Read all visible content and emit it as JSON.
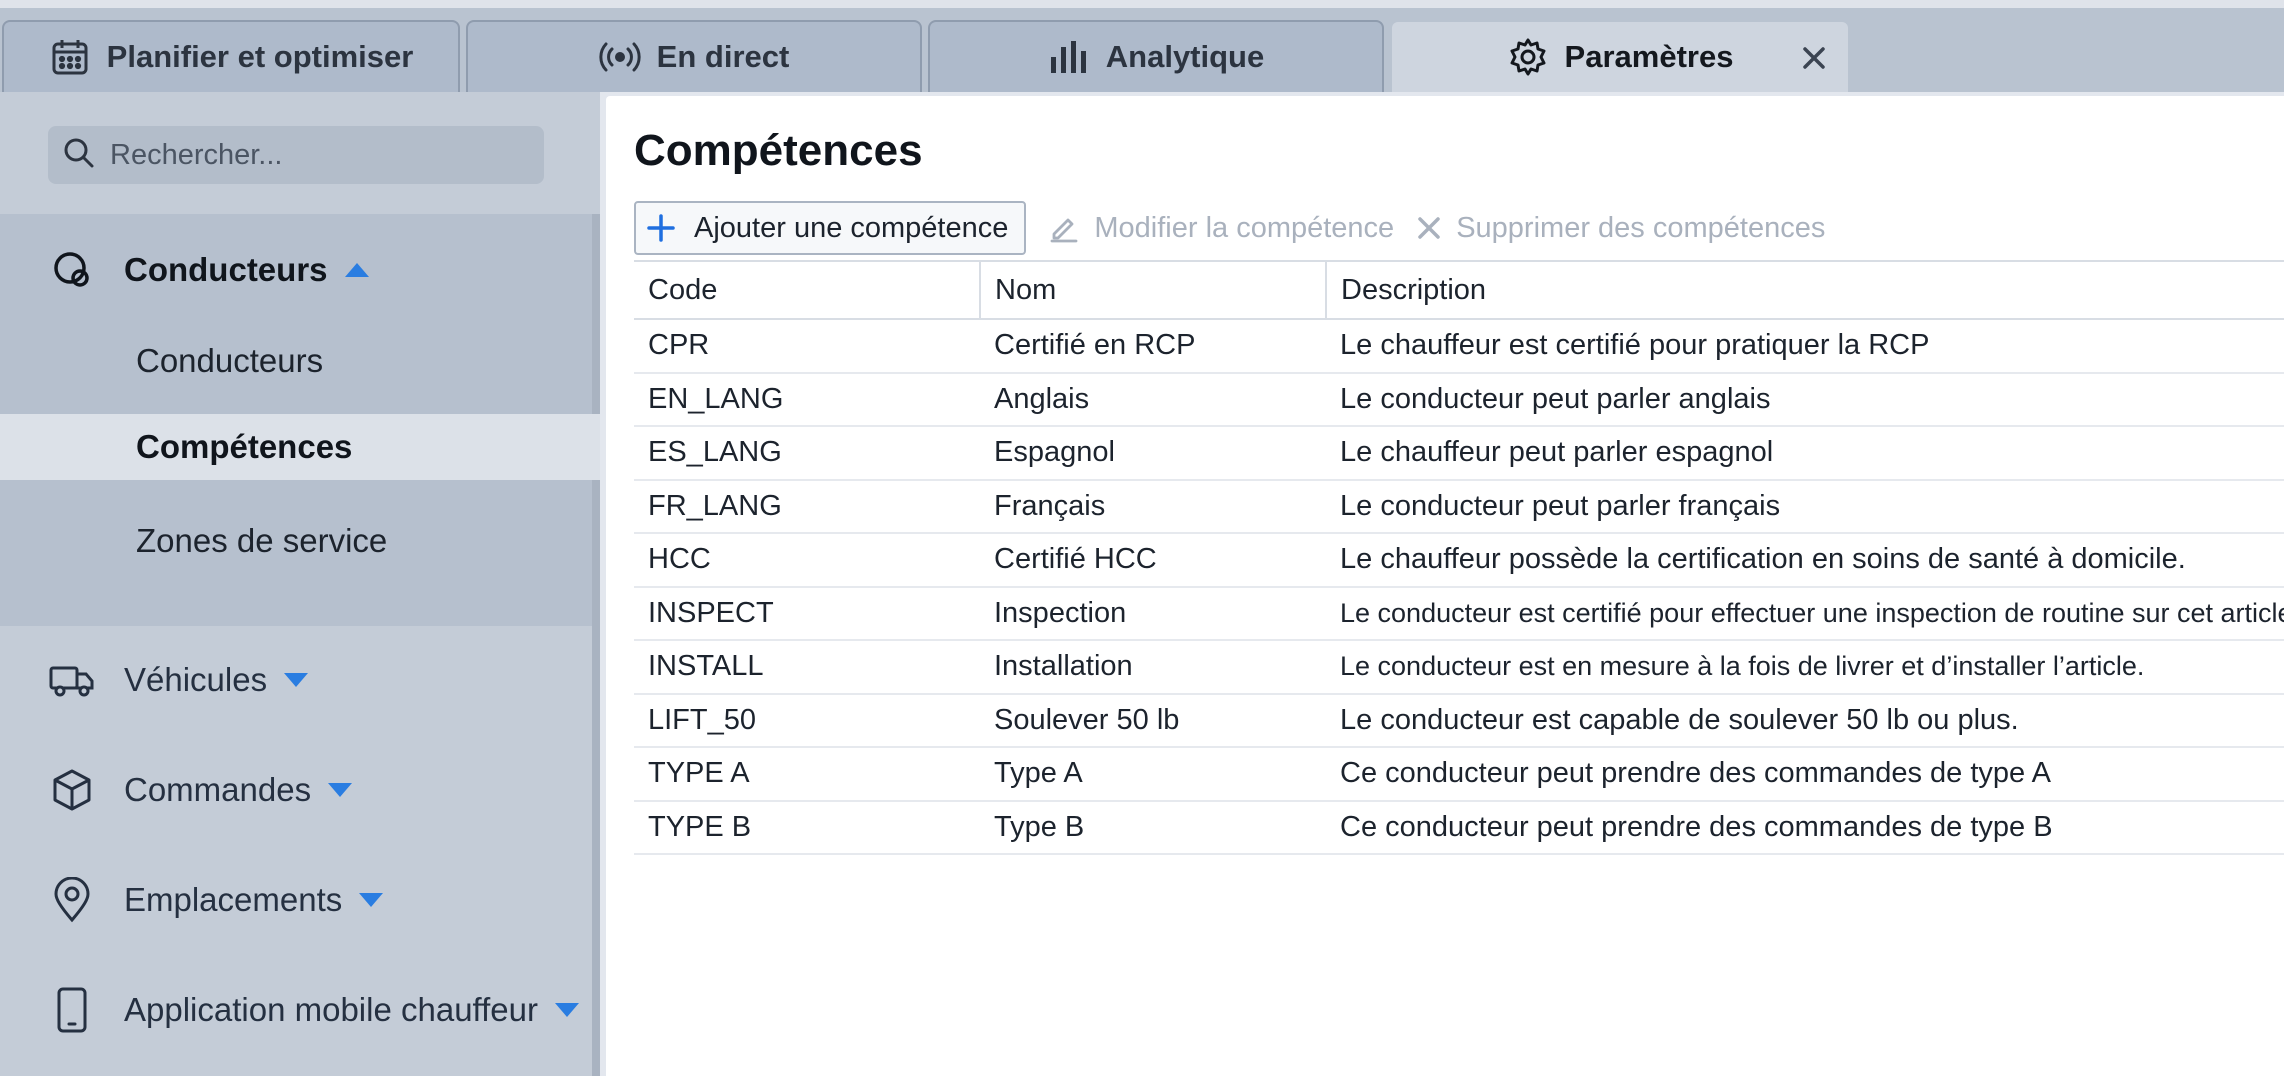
{
  "tabs": [
    {
      "label": "Planifier et optimiser",
      "icon": "calendar-icon"
    },
    {
      "label": "En direct",
      "icon": "broadcast-icon"
    },
    {
      "label": "Analytique",
      "icon": "bar-chart-icon"
    },
    {
      "label": "Paramètres",
      "icon": "gear-icon",
      "active": true
    }
  ],
  "search": {
    "placeholder": "Rechercher..."
  },
  "sidebar": {
    "groups": [
      {
        "label": "Conducteurs",
        "icon": "driver-icon",
        "expanded": true,
        "items": [
          "Conducteurs",
          "Compétences",
          "Zones de service"
        ],
        "selected": "Compétences"
      },
      {
        "label": "Véhicules",
        "icon": "truck-icon"
      },
      {
        "label": "Commandes",
        "icon": "package-icon"
      },
      {
        "label": "Emplacements",
        "icon": "location-pin-icon"
      },
      {
        "label": "Application mobile chauffeur",
        "icon": "mobile-phone-icon"
      }
    ]
  },
  "main": {
    "title": "Compétences",
    "toolbar": {
      "add": "Ajouter une compétence",
      "edit": "Modifier la compétence",
      "delete": "Supprimer des compétences"
    },
    "table": {
      "headers": [
        "Code",
        "Nom",
        "Description"
      ],
      "rows": [
        [
          "CPR",
          "Certifié en RCP",
          "Le chauffeur est certifié pour pratiquer la RCP"
        ],
        [
          "EN_LANG",
          "Anglais",
          "Le conducteur peut parler anglais"
        ],
        [
          "ES_LANG",
          "Espagnol",
          "Le chauffeur peut parler espagnol"
        ],
        [
          "FR_LANG",
          "Français",
          "Le conducteur peut parler français"
        ],
        [
          "HCC",
          "Certifié HCC",
          "Le chauffeur possède la certification en soins de santé à domicile."
        ],
        [
          "INSPECT",
          "Inspection",
          "Le conducteur est certifié pour effectuer une inspection de routine sur cet article."
        ],
        [
          "INSTALL",
          "Installation",
          "Le conducteur est en mesure à la fois de livrer et d’installer l’article."
        ],
        [
          "LIFT_50",
          "Soulever 50 lb",
          "Le conducteur est capable de soulever 50 lb ou plus."
        ],
        [
          "TYPE A",
          "Type A",
          "Ce conducteur peut prendre des commandes de type A"
        ],
        [
          "TYPE B",
          "Type B",
          "Ce conducteur peut prendre des commandes de type B"
        ]
      ]
    }
  },
  "colors": {
    "accent": "#1f6fe0",
    "caret": "#2a7de1",
    "disabled": "#a9b1bd"
  }
}
